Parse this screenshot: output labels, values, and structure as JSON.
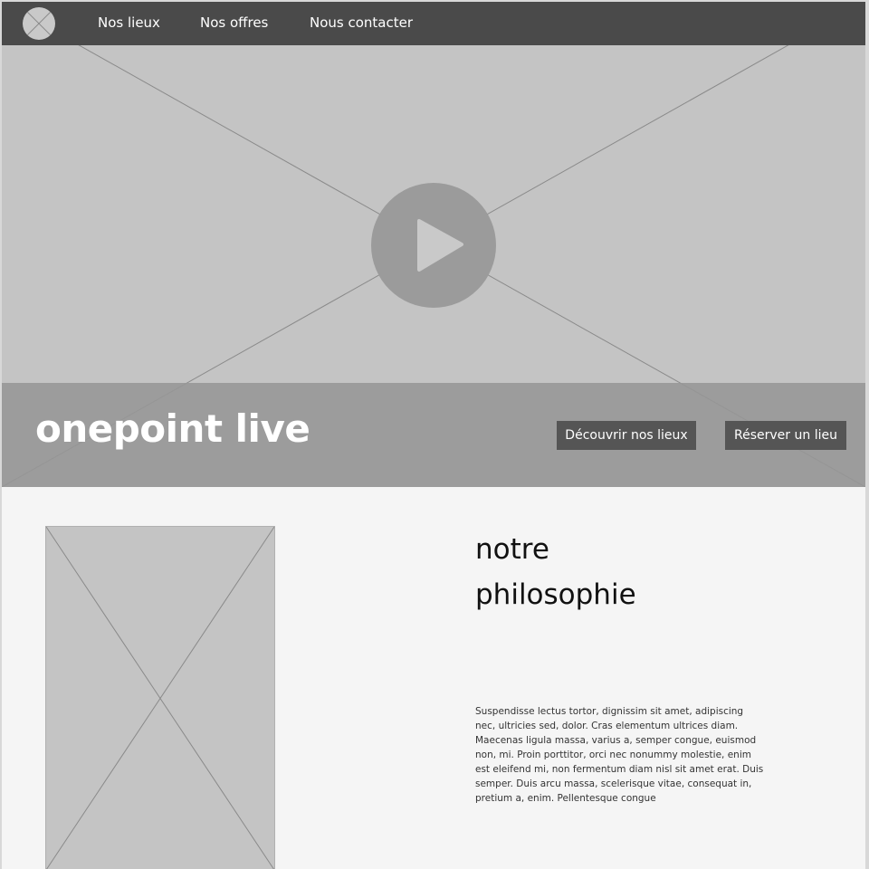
{
  "nav": {
    "links": [
      "Nos lieux",
      "Nos offres",
      "Nous contacter"
    ]
  },
  "hero": {
    "title": "onepoint live",
    "buttons": [
      "Découvrir nos lieux",
      "Réserver un lieu"
    ]
  },
  "philosophy": {
    "title": "notre philosophie",
    "body": "Suspendisse lectus tortor, dignissim sit amet, adipiscing nec, ultricies sed, dolor. Cras elementum ultrices diam. Maecenas ligula massa, varius a, semper congue, euismod non, mi. Proin porttitor, orci nec nonummy molestie, enim est eleifend mi, non fermentum diam nisl sit amet erat. Duis semper. Duis arcu massa, scelerisque vitae, consequat in, pretium a, enim. Pellentesque congue"
  },
  "colors": {
    "navbar": "#4a4a4a",
    "placeholder": "#c4c4c4",
    "title_bar": "#969696",
    "button": "#555555",
    "background": "#f5f5f5"
  },
  "icons": {
    "logo": "logo-placeholder-icon",
    "play": "play-icon"
  }
}
